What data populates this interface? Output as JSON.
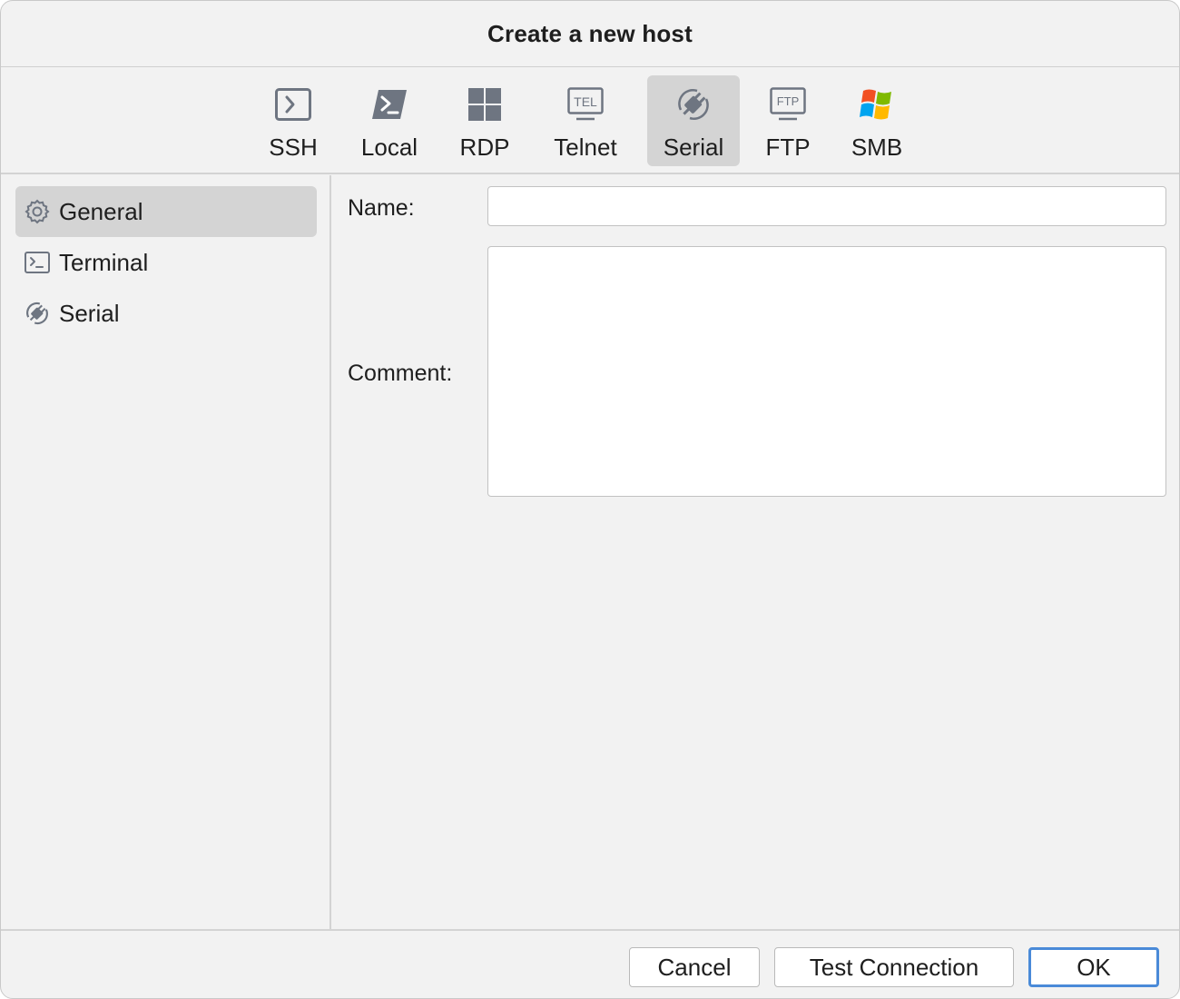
{
  "dialog": {
    "title": "Create a new host"
  },
  "toolbar": {
    "items": [
      {
        "label": "SSH",
        "icon": "ssh-terminal-icon"
      },
      {
        "label": "Local",
        "icon": "local-powershell-icon"
      },
      {
        "label": "RDP",
        "icon": "rdp-windows-tiles-icon"
      },
      {
        "label": "Telnet",
        "icon": "telnet-monitor-icon"
      },
      {
        "label": "Serial",
        "icon": "serial-plug-icon",
        "selected": true
      },
      {
        "label": "FTP",
        "icon": "ftp-monitor-icon"
      },
      {
        "label": "SMB",
        "icon": "smb-windows-flag-icon"
      }
    ]
  },
  "sidebar": {
    "items": [
      {
        "label": "General",
        "icon": "gear-icon",
        "selected": true
      },
      {
        "label": "Terminal",
        "icon": "terminal-icon"
      },
      {
        "label": "Serial",
        "icon": "serial-plug-icon"
      }
    ]
  },
  "form": {
    "name_label": "Name:",
    "name_value": "",
    "comment_label": "Comment:",
    "comment_value": ""
  },
  "footer": {
    "cancel_label": "Cancel",
    "test_label": "Test Connection",
    "ok_label": "OK"
  },
  "colors": {
    "background": "#f2f2f2",
    "selected_bg": "#d4d4d4",
    "icon_gray": "#6e7581",
    "default_button_border": "#4a8ad8"
  }
}
